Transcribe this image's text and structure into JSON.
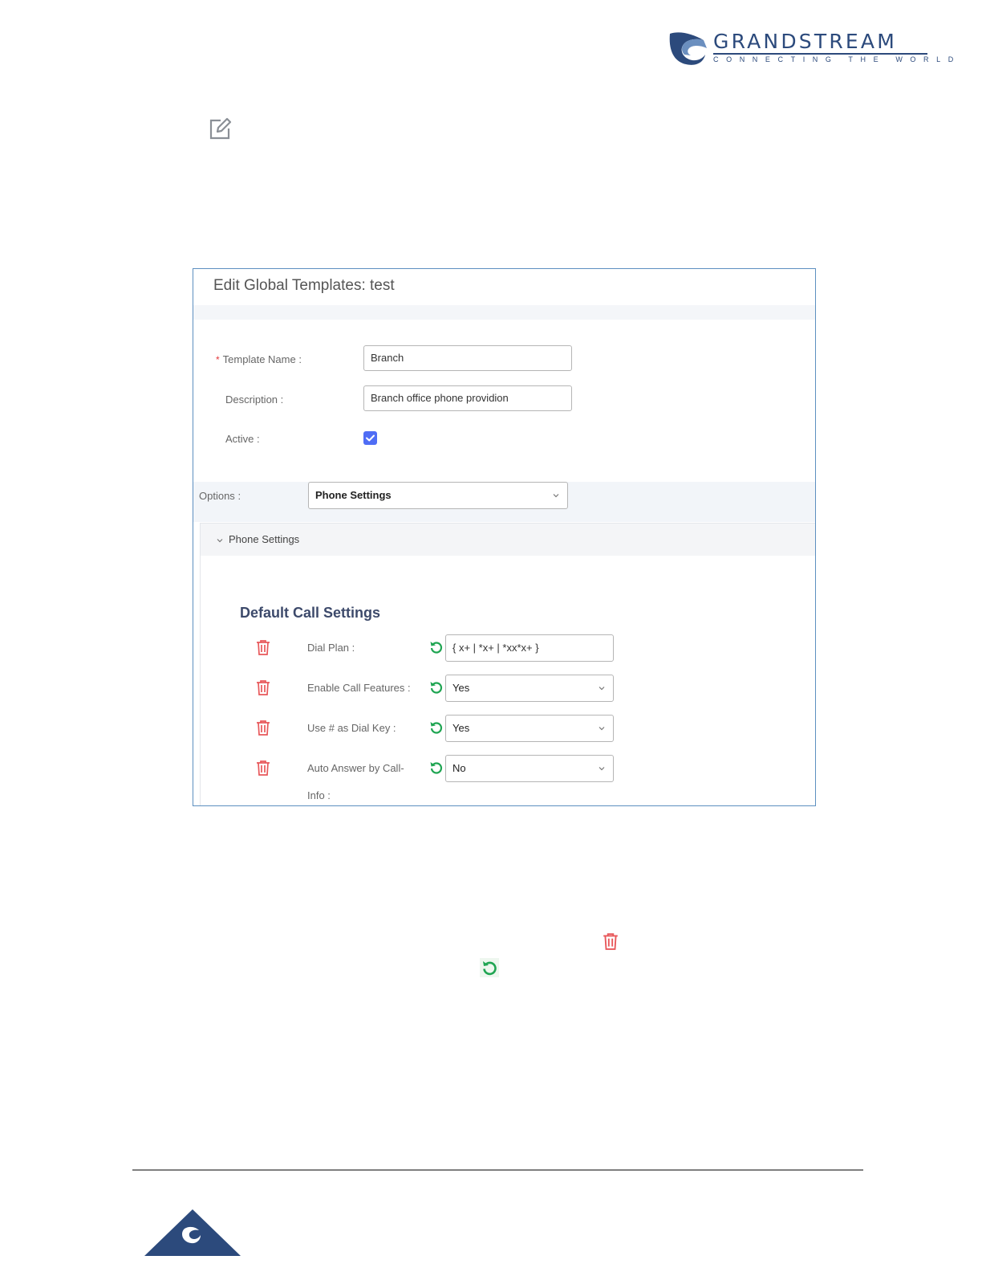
{
  "logo": {
    "wordmark": "GRANDSTREAM",
    "tagline": "CONNECTING THE WORLD",
    "brand_color": "#2c4a7c"
  },
  "icons": {
    "page_edit": "edit-icon",
    "trash": "trash-icon",
    "reset": "reset-icon",
    "chevron": "chevron-down-icon"
  },
  "dialog": {
    "title": "Edit Global Templates: test",
    "fields": {
      "template_name": {
        "label": "Template Name",
        "colon": ":",
        "required_mark": "*",
        "value": "Branch"
      },
      "description": {
        "label": "Description",
        "colon": ":",
        "value": "Branch office phone providion"
      },
      "active": {
        "label": "Active",
        "colon": ":",
        "checked": true
      }
    },
    "options": {
      "label": "Options",
      "colon": ":",
      "selected": "Phone Settings"
    },
    "section": {
      "header": "Phone Settings",
      "group_title": "Default Call Settings",
      "rows": [
        {
          "label": "Dial Plan :",
          "value": "{ x+ | *x+ | *xx*x+ }",
          "kind": "input"
        },
        {
          "label": "Enable Call Features :",
          "value": "Yes",
          "kind": "select"
        },
        {
          "label": "Use # as Dial Key :",
          "value": "Yes",
          "kind": "select"
        },
        {
          "label": "Auto Answer by Call-",
          "label_line2": "Info :",
          "value": "No",
          "kind": "select"
        }
      ]
    }
  },
  "colors": {
    "accent_blue": "#4f6df5",
    "trash_red": "#e8575a",
    "reset_green": "#1fa552",
    "dialog_border": "#5d8fc0"
  }
}
